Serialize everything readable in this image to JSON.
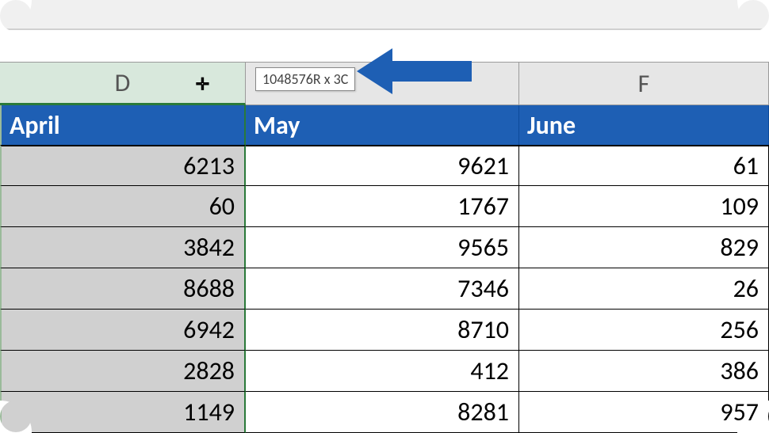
{
  "column_headers": {
    "d": "D",
    "e": "",
    "f": "F"
  },
  "selection_tooltip": "1048576R x 3C",
  "table": {
    "headers": {
      "d": "April",
      "e": "May",
      "f": "June"
    },
    "rows": [
      {
        "d": "6213",
        "e": "9621",
        "f": "61"
      },
      {
        "d": "60",
        "e": "1767",
        "f": "109"
      },
      {
        "d": "3842",
        "e": "9565",
        "f": "829"
      },
      {
        "d": "8688",
        "e": "7346",
        "f": "26"
      },
      {
        "d": "6942",
        "e": "8710",
        "f": "256"
      },
      {
        "d": "2828",
        "e": "412",
        "f": "386"
      },
      {
        "d": "1149",
        "e": "8281",
        "f": "957"
      }
    ]
  },
  "colors": {
    "header_blue": "#1e5fb4",
    "selected_col": "#d8e8dc",
    "selected_cells": "#d0d0d0",
    "arrow": "#1e5fb4"
  }
}
